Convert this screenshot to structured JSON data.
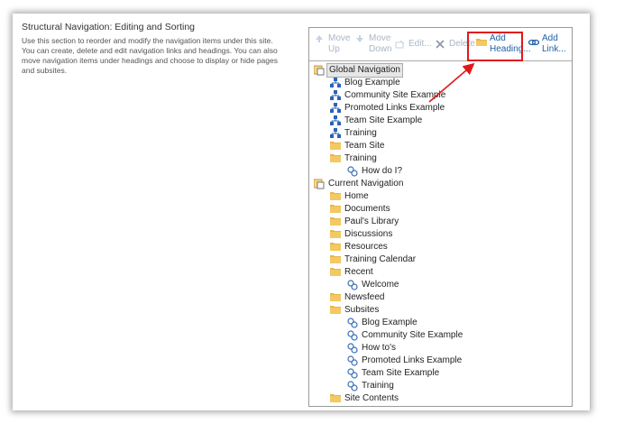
{
  "section": {
    "title": "Structural Navigation: Editing and Sorting",
    "description": "Use this section to reorder and modify the navigation items under this site. You can create, delete and edit navigation links and headings. You can also move navigation items under headings and choose to display or hide pages and subsites."
  },
  "toolbar": {
    "move_up": [
      "Move",
      "Up"
    ],
    "move_down": [
      "Move",
      "Down"
    ],
    "edit": "Edit...",
    "delete": "Delete",
    "add_heading": [
      "Add",
      "Heading..."
    ],
    "add_link": [
      "Add",
      "Link..."
    ]
  },
  "tree": {
    "global": {
      "label": "Global Navigation",
      "items": [
        "Blog Example",
        "Community Site Example",
        "Promoted Links Example",
        "Team Site Example",
        "Training",
        "Team Site",
        "Training",
        "How do I?"
      ]
    },
    "current": {
      "label": "Current Navigation",
      "items": [
        "Home",
        "Documents",
        "Paul's Library",
        "Discussions",
        "Resources",
        "Training Calendar",
        "Recent",
        "Welcome",
        "Newsfeed",
        "Subsites",
        "Blog Example",
        "Community Site Example",
        "How to's",
        "Promoted Links Example",
        "Team Site Example",
        "Training",
        "Site Contents"
      ]
    }
  },
  "colors": {
    "callout": "#e0181a",
    "link_active": "#1f5fa8",
    "disabled": "#a9b6c8",
    "folder": "#e8b64a"
  }
}
